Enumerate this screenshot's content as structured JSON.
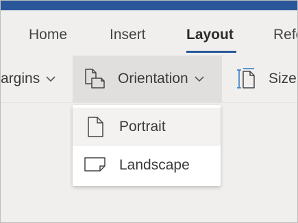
{
  "tabs": [
    {
      "label": "Home"
    },
    {
      "label": "Insert"
    },
    {
      "label": "Layout",
      "active": true
    },
    {
      "label": "Refe"
    }
  ],
  "ribbon": {
    "margins_label": "argins",
    "orientation_label": "Orientation",
    "size_label": "Size"
  },
  "menu": {
    "items": [
      {
        "label": "Portrait",
        "icon": "portrait-page-icon",
        "hovered": true
      },
      {
        "label": "Landscape",
        "icon": "landscape-page-icon"
      }
    ]
  },
  "colors": {
    "title_bar": "#2a579a",
    "accent_underline": "#2a579a",
    "size_icon_accent": "#2b78c5",
    "ribbon_bg": "#f0efee",
    "pressed_bg": "#e1dfdd",
    "menu_hover_bg": "#f3f2f1"
  }
}
